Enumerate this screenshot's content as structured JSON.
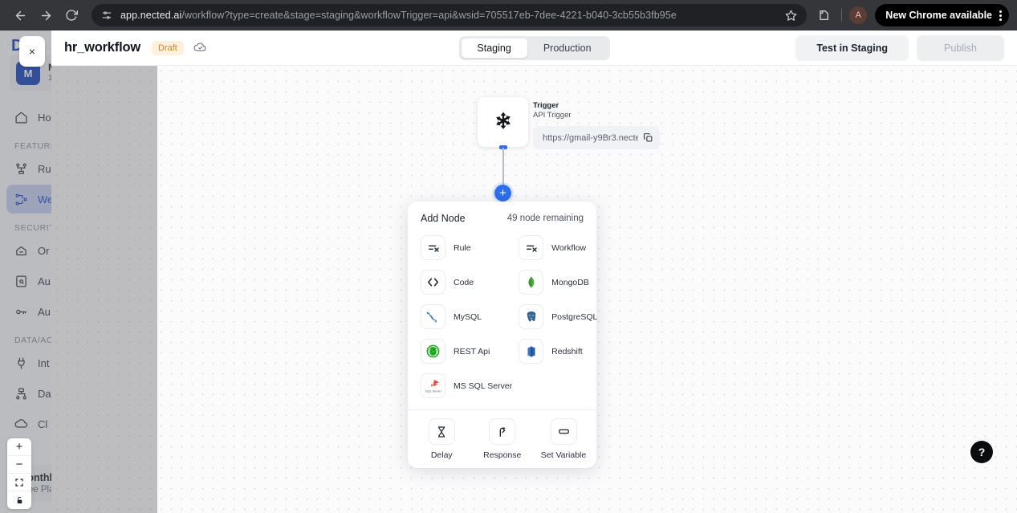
{
  "browser": {
    "back_icon": "back-arrow-icon",
    "forward_icon": "forward-arrow-icon",
    "reload_icon": "reload-icon",
    "site_settings_icon": "tune-icon",
    "url_domain": "app.nected.ai",
    "url_path": "/workflow?type=create&stage=staging&workflowTrigger=api&wsid=705517eb-7dee-4221-b040-3cb55b3fb95e",
    "bookmark_icon": "star-icon",
    "extensions_icon": "extensions-icon",
    "profile_initial": "A",
    "update_label": "New Chrome available",
    "menu_icon": "kebab-menu-icon"
  },
  "sidebar": {
    "logo_text": "D",
    "close_label": "×",
    "workspace": {
      "initial": "M",
      "name": "M",
      "sub": "1"
    },
    "home": {
      "label": "Ho"
    },
    "sections": [
      {
        "title": "FEATURES",
        "items": [
          {
            "label": "Ru",
            "icon": "rules-icon",
            "active": false
          },
          {
            "label": "We",
            "icon": "workflow-icon",
            "active": true
          }
        ]
      },
      {
        "title": "SECURITY",
        "items": [
          {
            "label": "Or",
            "icon": "org-icon",
            "active": false
          },
          {
            "label": "Au",
            "icon": "audit-icon",
            "active": false
          },
          {
            "label": "Au",
            "icon": "key-icon",
            "active": false
          }
        ]
      },
      {
        "title": "DATA/ACTION",
        "items": [
          {
            "label": "Int",
            "icon": "plug-icon",
            "active": false
          },
          {
            "label": "Da",
            "icon": "datasource-icon",
            "active": false
          },
          {
            "label": "Cl",
            "icon": "cloud-icon",
            "active": false
          }
        ]
      }
    ],
    "plan": {
      "title": "Monthly",
      "sub": "Free Plan"
    }
  },
  "topbar": {
    "workflow_name": "hr_workflow",
    "status_badge": "Draft",
    "saved_icon": "cloud-check-icon",
    "env_options": [
      {
        "label": "Staging",
        "active": true
      },
      {
        "label": "Production",
        "active": false
      }
    ],
    "test_button": "Test in Staging",
    "publish_button": "Publish"
  },
  "canvas": {
    "trigger": {
      "drag_icon": "move-handle-icon",
      "title": "Trigger",
      "subtitle": "API Trigger",
      "url_value": "https://gmail-y9Br3.necte",
      "copy_icon": "copy-icon"
    },
    "add_button_label": "+",
    "zoom_controls": [
      {
        "label": "+",
        "name": "zoom-in-button"
      },
      {
        "label": "−",
        "name": "zoom-out-button"
      },
      {
        "label": "fit-screen-icon",
        "name": "fit-view-button"
      },
      {
        "label": "lock-icon",
        "name": "lock-canvas-button"
      }
    ],
    "help_label": "?"
  },
  "add_node_panel": {
    "title": "Add Node",
    "count_label": "49 node remaining",
    "nodes": [
      {
        "label": "Rule",
        "icon": "rule-icon"
      },
      {
        "label": "Workflow",
        "icon": "workflow-icon"
      },
      {
        "label": "Code",
        "icon": "code-icon"
      },
      {
        "label": "MongoDB",
        "icon": "mongodb-icon"
      },
      {
        "label": "MySQL",
        "icon": "mysql-icon"
      },
      {
        "label": "PostgreSQL",
        "icon": "postgresql-icon"
      },
      {
        "label": "REST Api",
        "icon": "rest-api-icon"
      },
      {
        "label": "Redshift",
        "icon": "redshift-icon"
      },
      {
        "label": "MS SQL Server",
        "icon": "mssql-icon"
      }
    ],
    "utility_nodes": [
      {
        "label": "Delay",
        "icon": "hourglass-icon"
      },
      {
        "label": "Response",
        "icon": "arrow-up-icon"
      },
      {
        "label": "Set Variable",
        "icon": "variable-icon"
      }
    ]
  },
  "colors": {
    "accent_blue": "#2f6fed",
    "brand_blue": "#1a49ba",
    "draft_amber": "#c58a2a",
    "mongo_green": "#4faa41",
    "rest_green": "#1aa916"
  }
}
